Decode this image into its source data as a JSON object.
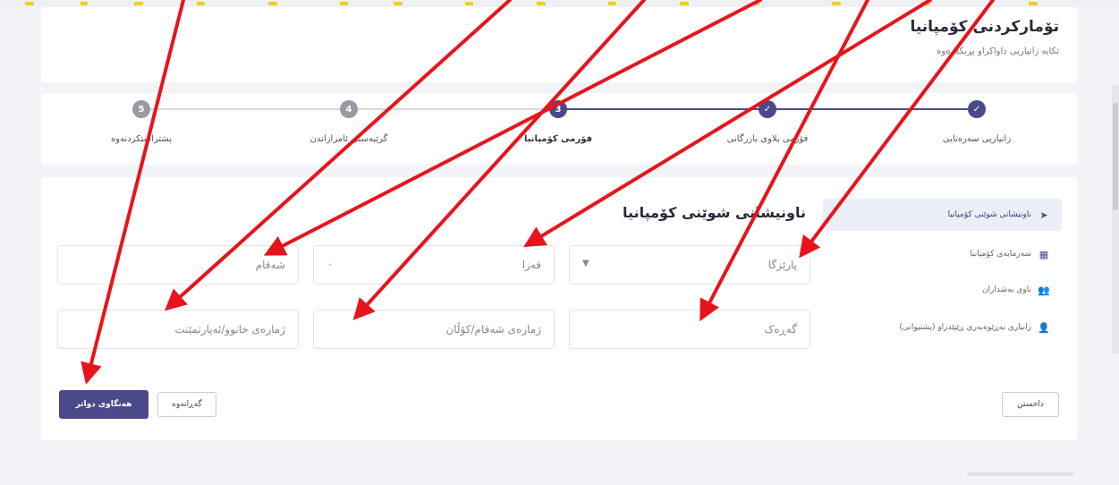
{
  "header": {
    "title": "تۆمارکردنی کۆمپانیا",
    "subtitle": "تکایە زانیاریی داواکراو پڕبکەرەوە"
  },
  "steps": [
    {
      "num": "",
      "label": "زانیاریی سەرەتایی",
      "state": "done"
    },
    {
      "num": "",
      "label": "فۆرمی بلاوی بازرگانی",
      "state": "done"
    },
    {
      "num": "3",
      "label": "فۆرمی کۆمپانیا",
      "state": "current"
    },
    {
      "num": "4",
      "label": "گرێبەستی ئامرازاندن",
      "state": "todo"
    },
    {
      "num": "5",
      "label": "پشتراستکردنەوە",
      "state": "todo"
    }
  ],
  "sidebar": {
    "items": [
      {
        "label": "ناونیشانی شوێنی کۆمپانیا",
        "icon": "send-icon"
      },
      {
        "label": "سەرمایەی کۆمپانیا",
        "icon": "building-icon"
      },
      {
        "label": "ناوی بەشداران",
        "icon": "users-icon"
      },
      {
        "label": "زانیاری بەڕێوەبەری ڕێپێدراو (پشتیوانی)",
        "icon": "user-icon"
      }
    ]
  },
  "form": {
    "title": "ناونیشانی شوێنی کۆمپانیا",
    "province_placeholder": "پارێزگا",
    "district_placeholder": "قەزا",
    "city_placeholder": "شەقام",
    "neighborhood_placeholder": "گەڕەک",
    "street_placeholder": "ژمارەی شەقام/کۆڵان",
    "building_placeholder": "ژمارەی خانوو/ئەپارتمێنت"
  },
  "buttons": {
    "save": "هەنگاوی دواتر",
    "back": "گەڕانەوە",
    "exit": "داخستن"
  },
  "colors": {
    "accent": "#4a4a8a",
    "annotation": "#e8141c"
  }
}
